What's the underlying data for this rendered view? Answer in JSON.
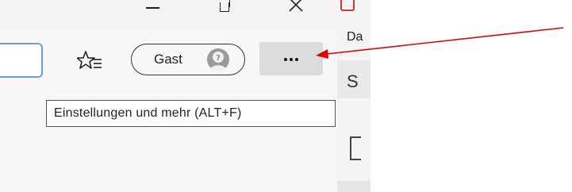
{
  "toolbar": {
    "favorites_icon": "star-list-icon",
    "guest_label": "Gast",
    "avatar_icon": "guest-avatar-icon",
    "menu_icon": "ellipsis-icon"
  },
  "window_controls": {
    "minimize_icon": "minimize-icon",
    "restore_icon": "restore-icon",
    "close_icon": "close-icon"
  },
  "tooltip": {
    "text": "Einstellungen und mehr (ALT+F)"
  },
  "side_app": {
    "label": "Da",
    "letter": "S"
  },
  "annotation": {
    "arrow_color": "#e00000"
  },
  "colors": {
    "focus_border": "#6aa0d8",
    "menu_hover": "#dcdcdc"
  }
}
